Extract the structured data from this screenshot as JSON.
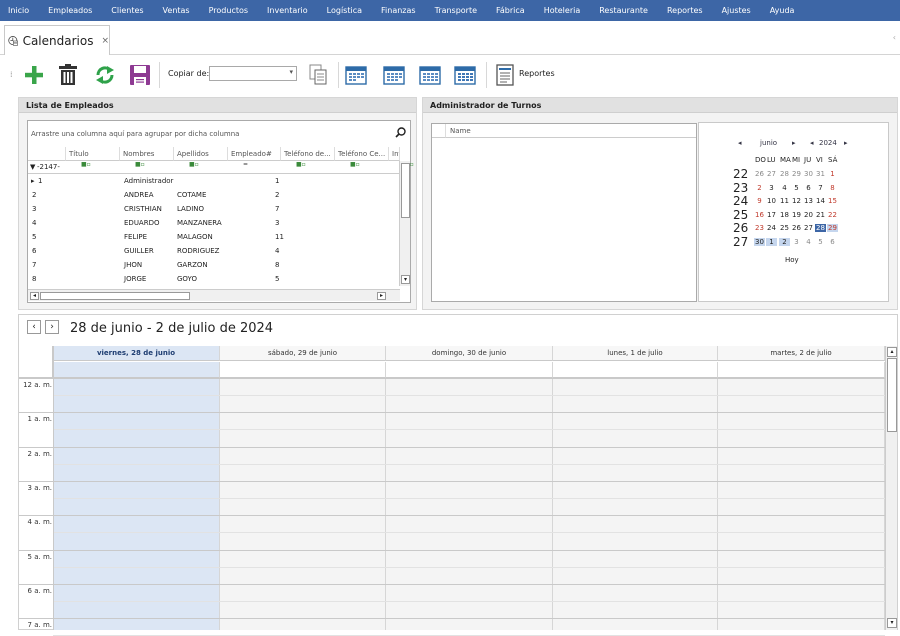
{
  "menu": [
    "Inicio",
    "Empleados",
    "Clientes",
    "Ventas",
    "Productos",
    "Inventario",
    "Logística",
    "Finanzas",
    "Transporte",
    "Fábrica",
    "Hoteleria",
    "Restaurante",
    "Reportes",
    "Ajustes",
    "Ayuda"
  ],
  "tab": {
    "title": "Calendarios",
    "close": "×",
    "scroll_right": "‹"
  },
  "toolbar": {
    "copy_label": "Copiar de:",
    "copy_value": "",
    "reports_label": "Reportes"
  },
  "employees": {
    "title": "Lista de Empleados",
    "group_hint": "Arrastre una columna aquí para agrupar por dicha columna",
    "columns": [
      "Título",
      "Nombres",
      "Apellidos",
      "Empleado#",
      "Teléfono de...",
      "Teléfono Ce...",
      "Infor"
    ],
    "filter_value": "-2147-",
    "rows": [
      {
        "id": "1",
        "nombres": "Administrador",
        "apellidos": "",
        "num": "1"
      },
      {
        "id": "2",
        "nombres": "ANDREA",
        "apellidos": "COTAME",
        "num": "2"
      },
      {
        "id": "3",
        "nombres": "CRISTHIAN",
        "apellidos": "LADINO",
        "num": "7"
      },
      {
        "id": "4",
        "nombres": "EDUARDO",
        "apellidos": "MANZANERA",
        "num": "3"
      },
      {
        "id": "5",
        "nombres": "FELIPE",
        "apellidos": "MALAGON",
        "num": "11"
      },
      {
        "id": "6",
        "nombres": "GUILLER",
        "apellidos": "RODRIGUEZ",
        "num": "4"
      },
      {
        "id": "7",
        "nombres": "JHON",
        "apellidos": "GARZON",
        "num": "8"
      },
      {
        "id": "8",
        "nombres": "JORGE",
        "apellidos": "GOYO",
        "num": "5"
      }
    ]
  },
  "shifts": {
    "title": "Administrador de Turnos",
    "name_col": "Name"
  },
  "mini_calendar": {
    "month": "junio",
    "year": "2024",
    "weekdays": [
      "DO",
      "LU",
      "MA",
      "MI",
      "JU",
      "VI",
      "SÁ"
    ],
    "weeks": [
      {
        "wk": "22",
        "days": [
          "26",
          "27",
          "28",
          "29",
          "30",
          "31",
          "1"
        ]
      },
      {
        "wk": "23",
        "days": [
          "2",
          "3",
          "4",
          "5",
          "6",
          "7",
          "8"
        ]
      },
      {
        "wk": "24",
        "days": [
          "9",
          "10",
          "11",
          "12",
          "13",
          "14",
          "15"
        ]
      },
      {
        "wk": "25",
        "days": [
          "16",
          "17",
          "18",
          "19",
          "20",
          "21",
          "22"
        ]
      },
      {
        "wk": "26",
        "days": [
          "23",
          "24",
          "25",
          "26",
          "27",
          "28",
          "29"
        ]
      },
      {
        "wk": "27",
        "days": [
          "30",
          "1",
          "2",
          "3",
          "4",
          "5",
          "6"
        ]
      }
    ],
    "today_label": "Hoy"
  },
  "scheduler": {
    "range_title": "28 de junio - 2 de julio de 2024",
    "days": [
      "viernes, 28 de junio",
      "sábado, 29 de junio",
      "domingo, 30 de junio",
      "lunes, 1 de julio",
      "martes, 2 de julio"
    ],
    "times": [
      "12 a. m.",
      "1 a. m.",
      "2 a. m.",
      "3 a. m.",
      "4 a. m.",
      "5 a. m.",
      "6 a. m.",
      "7 a. m."
    ]
  },
  "colors": {
    "menubar": "#3d66a6",
    "selected_day": "#dce6f4",
    "selected_header": "#c5d6ee",
    "weekend_red": "#c0392b",
    "selected_date": "#3d66a6"
  }
}
